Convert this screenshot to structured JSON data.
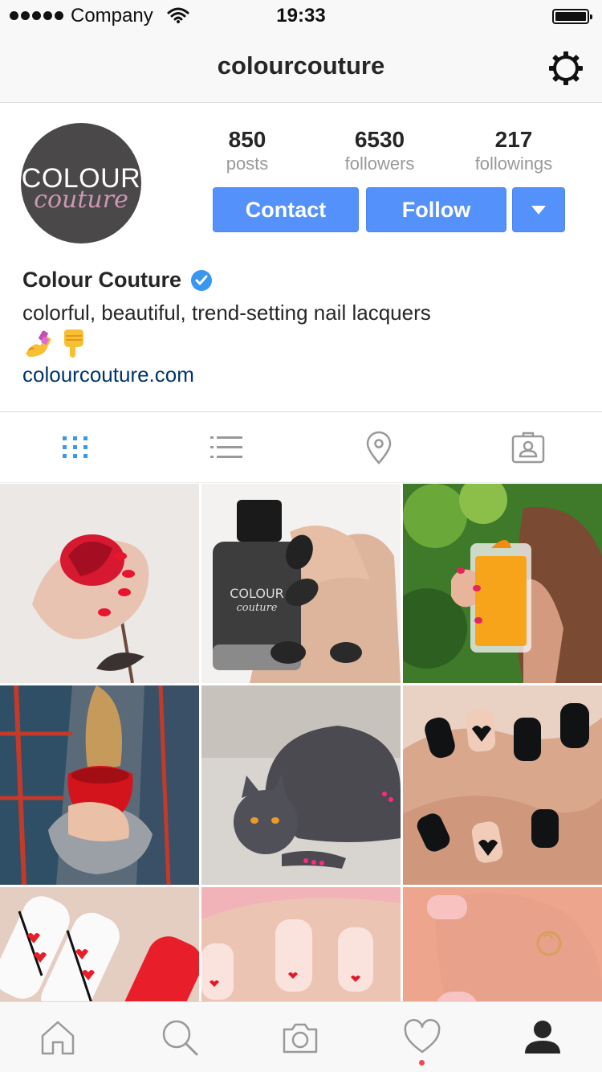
{
  "status_bar": {
    "carrier": "Company",
    "time": "19:33"
  },
  "nav": {
    "title": "colourcouture",
    "settings_icon": "gear-icon"
  },
  "profile": {
    "avatar_logo": {
      "line1": "COLOUR",
      "line2": "couture"
    },
    "stats": [
      {
        "value": "850",
        "label": "posts"
      },
      {
        "value": "6530",
        "label": "followers"
      },
      {
        "value": "217",
        "label": "followings"
      }
    ],
    "buttons": {
      "contact": "Contact",
      "follow": "Follow",
      "more_icon": "caret-down-icon"
    },
    "full_name": "Colour Couture",
    "verified": true,
    "bio": "colorful, beautiful, trend-setting nail lacquers",
    "bio_emojis": [
      "nail-polish-emoji",
      "pointing-down-emoji"
    ],
    "website": "colourcouture.com"
  },
  "view_tabs": [
    {
      "icon": "grid-icon",
      "active": true
    },
    {
      "icon": "list-icon",
      "active": false
    },
    {
      "icon": "location-pin-icon",
      "active": false
    },
    {
      "icon": "tagged-person-icon",
      "active": false
    }
  ],
  "grid_posts": [
    "red rose held by hand with red nails",
    "glitter black nail polish bottle and nails",
    "hand holding glass of orange juice",
    "hands holding red heart mug",
    "grey cat with pink painted claws",
    "black nails with heart design",
    "white nails with red arrow hearts",
    "pale pink nails with small red hearts",
    "pink nails with heart ring"
  ],
  "tab_bar": [
    {
      "icon": "home-icon"
    },
    {
      "icon": "search-icon"
    },
    {
      "icon": "camera-icon"
    },
    {
      "icon": "heart-icon",
      "has_notification": true
    },
    {
      "icon": "profile-icon",
      "active": true
    }
  ],
  "colors": {
    "accent": "#5591fb",
    "verified": "#3897f0",
    "link": "#003569",
    "active_tab": "#3897f0",
    "notification": "#ed4956"
  }
}
